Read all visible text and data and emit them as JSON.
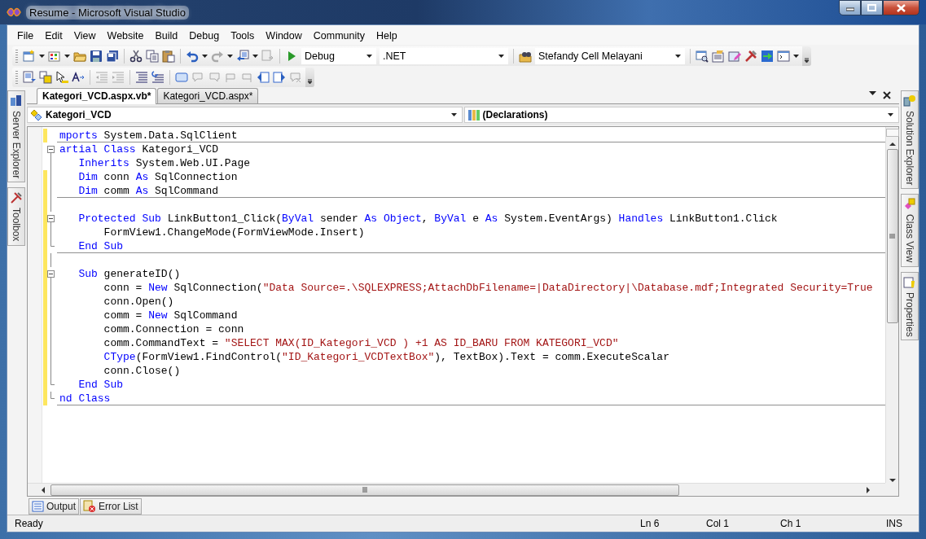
{
  "window": {
    "title": "Resume - Microsoft Visual Studio"
  },
  "menu": [
    "File",
    "Edit",
    "View",
    "Website",
    "Build",
    "Debug",
    "Tools",
    "Window",
    "Community",
    "Help"
  ],
  "toolbar": {
    "configuration": "Debug",
    "platform": ".NET",
    "project": "Stefandy Cell Melayani"
  },
  "left_dock": [
    "Server Explorer",
    "Toolbox"
  ],
  "right_dock": [
    "Solution Explorer",
    "Class View",
    "Properties"
  ],
  "document_tabs": [
    {
      "label": "Kategori_VCD.aspx.vb*",
      "selected": true
    },
    {
      "label": "Kategori_VCD.aspx*",
      "selected": false
    }
  ],
  "navigation": {
    "class": "Kategori_VCD",
    "member": "(Declarations)"
  },
  "editor": {
    "lines": [
      {
        "tokens": [
          {
            "kind": "keyword",
            "text": "mports"
          },
          {
            "kind": "plain",
            "text": " System.Data.SqlClient"
          }
        ],
        "changed": true,
        "collapsible": false,
        "block_end": false,
        "separator": true
      },
      {
        "tokens": [
          {
            "kind": "keyword",
            "text": "artial Class"
          },
          {
            "kind": "plain",
            "text": " Kategori_VCD"
          }
        ],
        "changed": false,
        "collapsible": true,
        "block_end": false,
        "separator": false
      },
      {
        "tokens": [
          {
            "kind": "keyword",
            "text": "   Inherits"
          },
          {
            "kind": "plain",
            "text": " System.Web.UI.Page"
          }
        ],
        "changed": false,
        "collapsible": false,
        "block_end": false,
        "separator": false
      },
      {
        "tokens": [
          {
            "kind": "keyword",
            "text": "   Dim"
          },
          {
            "kind": "plain",
            "text": " conn "
          },
          {
            "kind": "keyword",
            "text": "As"
          },
          {
            "kind": "plain",
            "text": " SqlConnection"
          }
        ],
        "changed": true,
        "collapsible": false,
        "block_end": false,
        "separator": false
      },
      {
        "tokens": [
          {
            "kind": "keyword",
            "text": "   Dim"
          },
          {
            "kind": "plain",
            "text": " comm "
          },
          {
            "kind": "keyword",
            "text": "As"
          },
          {
            "kind": "plain",
            "text": " SqlCommand"
          }
        ],
        "changed": true,
        "collapsible": false,
        "block_end": false,
        "separator": true
      },
      {
        "changed": true,
        "collapsible": false,
        "block_end": false,
        "separator": false
      },
      {
        "tokens": [
          {
            "kind": "keyword",
            "text": "   Protected Sub"
          },
          {
            "kind": "plain",
            "text": " LinkButton1_Click("
          },
          {
            "kind": "keyword",
            "text": "ByVal"
          },
          {
            "kind": "plain",
            "text": " sender "
          },
          {
            "kind": "keyword",
            "text": "As Object"
          },
          {
            "kind": "plain",
            "text": ", "
          },
          {
            "kind": "keyword",
            "text": "ByVal"
          },
          {
            "kind": "plain",
            "text": " e "
          },
          {
            "kind": "keyword",
            "text": "As"
          },
          {
            "kind": "plain",
            "text": " System.EventArgs) "
          },
          {
            "kind": "keyword",
            "text": "Handles"
          },
          {
            "kind": "plain",
            "text": " LinkButton1.Click"
          }
        ],
        "changed": true,
        "collapsible": true,
        "block_end": false,
        "separator": false
      },
      {
        "tokens": [
          {
            "kind": "plain",
            "text": "       FormView1.ChangeMode(FormViewMode.Insert)"
          }
        ],
        "changed": true,
        "collapsible": false,
        "block_end": false,
        "separator": false
      },
      {
        "tokens": [
          {
            "kind": "keyword",
            "text": "   End Sub"
          }
        ],
        "changed": true,
        "collapsible": false,
        "block_end": true,
        "separator": true
      },
      {
        "changed": true,
        "collapsible": false,
        "block_end": false,
        "separator": false
      },
      {
        "tokens": [
          {
            "kind": "keyword",
            "text": "   Sub"
          },
          {
            "kind": "plain",
            "text": " generateID()"
          }
        ],
        "changed": true,
        "collapsible": true,
        "block_end": false,
        "separator": false
      },
      {
        "tokens": [
          {
            "kind": "plain",
            "text": "       conn = "
          },
          {
            "kind": "keyword",
            "text": "New"
          },
          {
            "kind": "plain",
            "text": " SqlConnection("
          },
          {
            "kind": "string",
            "text": "\"Data Source=.\\SQLEXPRESS;AttachDbFilename=|DataDirectory|\\Database.mdf;Integrated Security=True"
          }
        ],
        "changed": true,
        "collapsible": false,
        "block_end": false,
        "separator": false
      },
      {
        "tokens": [
          {
            "kind": "plain",
            "text": "       conn.Open()"
          }
        ],
        "changed": true,
        "collapsible": false,
        "block_end": false,
        "separator": false
      },
      {
        "tokens": [
          {
            "kind": "plain",
            "text": "       comm = "
          },
          {
            "kind": "keyword",
            "text": "New"
          },
          {
            "kind": "plain",
            "text": " SqlCommand"
          }
        ],
        "changed": true,
        "collapsible": false,
        "block_end": false,
        "separator": false
      },
      {
        "tokens": [
          {
            "kind": "plain",
            "text": "       comm.Connection = conn"
          }
        ],
        "changed": true,
        "collapsible": false,
        "block_end": false,
        "separator": false
      },
      {
        "tokens": [
          {
            "kind": "plain",
            "text": "       comm.CommandText = "
          },
          {
            "kind": "string",
            "text": "\"SELECT MAX(ID_Kategori_VCD ) +1 AS ID_BARU FROM KATEGORI_VCD\""
          }
        ],
        "changed": true,
        "collapsible": false,
        "block_end": false,
        "separator": false
      },
      {
        "tokens": [
          {
            "kind": "keyword",
            "text": "       CType"
          },
          {
            "kind": "plain",
            "text": "(FormView1.FindControl("
          },
          {
            "kind": "string",
            "text": "\"ID_Kategori_VCDTextBox\""
          },
          {
            "kind": "plain",
            "text": "), TextBox).Text = comm.ExecuteScalar"
          }
        ],
        "changed": true,
        "collapsible": false,
        "block_end": false,
        "separator": false
      },
      {
        "tokens": [
          {
            "kind": "plain",
            "text": "       conn.Close()"
          }
        ],
        "changed": true,
        "collapsible": false,
        "block_end": false,
        "separator": false
      },
      {
        "tokens": [
          {
            "kind": "keyword",
            "text": "   End Sub"
          }
        ],
        "changed": true,
        "collapsible": false,
        "block_end": true,
        "separator": false
      },
      {
        "tokens": [
          {
            "kind": "keyword",
            "text": "nd Class"
          }
        ],
        "changed": true,
        "collapsible": false,
        "block_end": true,
        "separator": true
      }
    ]
  },
  "bottom_tabs": [
    "Output",
    "Error List"
  ],
  "status_bar": {
    "message": "Ready",
    "line": "Ln 6",
    "column": "Col 1",
    "char": "Ch 1",
    "mode": "INS"
  }
}
